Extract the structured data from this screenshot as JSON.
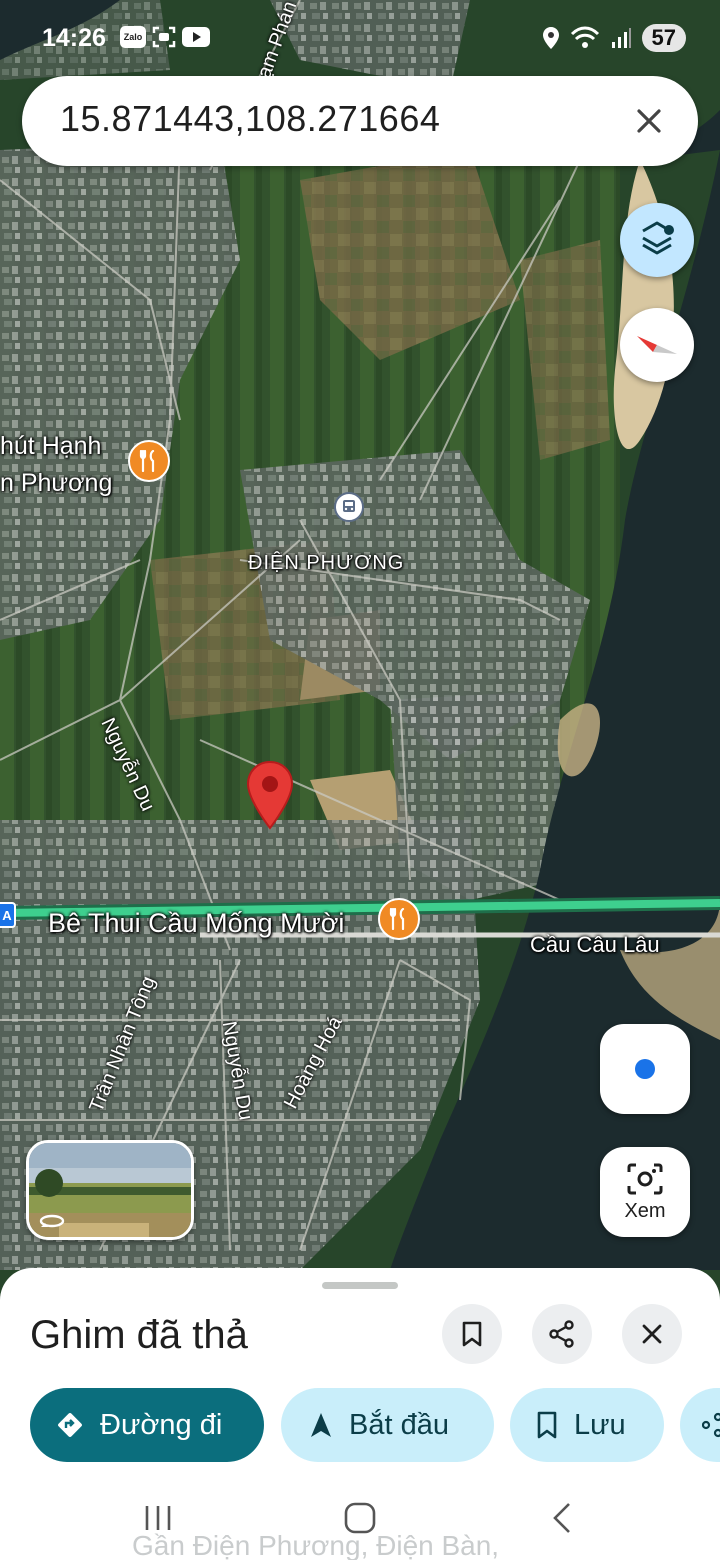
{
  "status_bar": {
    "time": "14:26",
    "app_icons": [
      "Zalo",
      "scan-icon",
      "youtube-icon"
    ],
    "battery": "57"
  },
  "search": {
    "query": "15.871443,108.271664"
  },
  "map": {
    "labels": {
      "poi_name_line1": "hút Hạnh",
      "poi_name_line2": "n Phương",
      "area": "ĐIỆN PHƯƠNG",
      "road_nguyen_du_1": "Nguyễn Du",
      "road_nguyen_du_2": "Nguyễn Du",
      "road_tran_nhan_tong": "Trần Nhân Tông",
      "road_hoang_hoa": "Hoàng Hoá",
      "road_pham_phan": "ạm Phán",
      "restaurant": "Bê Thui Cầu Mống Mười",
      "bridge": "Cầu Câu Lâu"
    },
    "colors": {
      "pin": "#e53935",
      "highway": "#3ecf8e",
      "poi": "#f08a24",
      "water": "#1d2c2f"
    }
  },
  "controls": {
    "lens_label": "Xem"
  },
  "sheet": {
    "title": "Ghim đã thả",
    "chips": {
      "directions": "Đường đi",
      "start": "Bắt đầu",
      "save": "Lưu"
    },
    "subtitle": "Gần Điện Phương, Điện Bàn,"
  }
}
